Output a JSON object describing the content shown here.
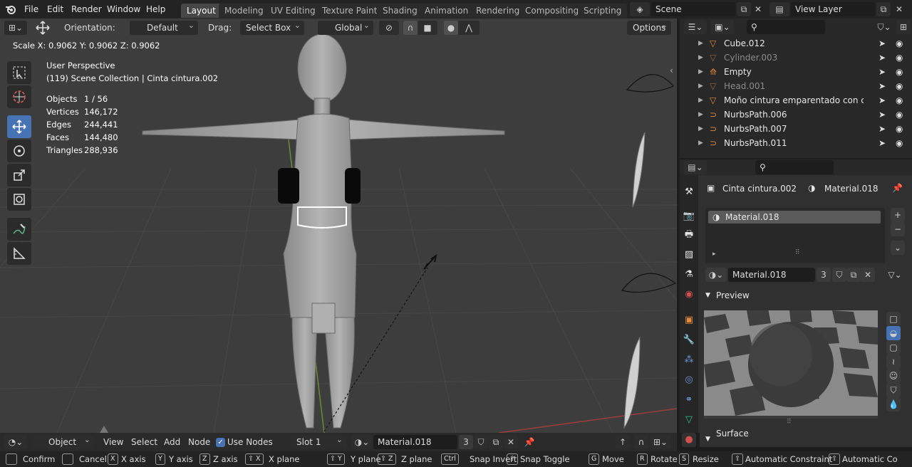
{
  "menus": [
    "File",
    "Edit",
    "Render",
    "Window",
    "Help"
  ],
  "workspaces": [
    "Layout",
    "Modeling",
    "UV Editing",
    "Texture Paint",
    "Shading",
    "Animation",
    "Rendering",
    "Compositing",
    "Scripting"
  ],
  "scene": {
    "name": "Scene",
    "view_layer": "View Layer"
  },
  "viewport_header": {
    "orientation_label": "Orientation:",
    "orientation_value": "Default",
    "drag_label": "Drag:",
    "drag_value": "Select Box",
    "transform_space": "Global",
    "options": "Options"
  },
  "operator_info": "Scale X: 0.9062   Y: 0.9062   Z: 0.9062",
  "viewport_info": {
    "perspective": "User Perspective",
    "collection": "(119) Scene Collection | Cinta cintura.002",
    "stats": [
      {
        "label": "Objects",
        "value": "1 / 56"
      },
      {
        "label": "Vertices",
        "value": "146,172"
      },
      {
        "label": "Edges",
        "value": "244,441"
      },
      {
        "label": "Faces",
        "value": "144,480"
      },
      {
        "label": "Triangles",
        "value": "288,936"
      }
    ]
  },
  "outliner": {
    "items": [
      {
        "name": "Cube.012",
        "icon": "mesh-icon",
        "dim": false
      },
      {
        "name": "Cylinder.003",
        "icon": "mesh-icon",
        "dim": true
      },
      {
        "name": "Empty",
        "icon": "empty-icon",
        "dim": false
      },
      {
        "name": "Head.001",
        "icon": "mesh-icon",
        "dim": true
      },
      {
        "name": "Moño cintura emparentado con cinta c",
        "icon": "mesh-icon",
        "dim": false
      },
      {
        "name": "NurbsPath.006",
        "icon": "curve-icon",
        "dim": false
      },
      {
        "name": "NurbsPath.007",
        "icon": "curve-icon",
        "dim": false
      },
      {
        "name": "NurbsPath.011",
        "icon": "curve-icon",
        "dim": false
      }
    ]
  },
  "properties": {
    "object_name": "Cinta cintura.002",
    "material_name": "Material.018",
    "slot_item": "Material.018",
    "material_field": "Material.018",
    "user_count": "3",
    "preview_label": "Preview",
    "surface_label": "Surface"
  },
  "node_bar": {
    "mode": "Object",
    "view": "View",
    "select": "Select",
    "add": "Add",
    "node": "Node",
    "use_nodes": "Use Nodes",
    "slot": "Slot 1",
    "material": "Material.018",
    "user_count": "3"
  },
  "status_bar": [
    {
      "key": "",
      "label": "Confirm"
    },
    {
      "key": "",
      "label": "Cancel"
    },
    {
      "key": "X",
      "label": "X axis"
    },
    {
      "key": "Y",
      "label": "Y axis"
    },
    {
      "key": "Z",
      "label": "Z axis"
    },
    {
      "key": "⇧ X",
      "label": "X plane"
    },
    {
      "key": "⇧ Y",
      "label": "Y plane"
    },
    {
      "key": "⇧ Z",
      "label": "Z plane"
    },
    {
      "key": "Ctrl",
      "label": "Snap Invert"
    },
    {
      "key": "⇧",
      "label": "Snap Toggle"
    },
    {
      "key": "G",
      "label": "Move"
    },
    {
      "key": "R",
      "label": "Rotate"
    },
    {
      "key": "S",
      "label": "Resize"
    },
    {
      "key": "⇧",
      "label": "Automatic Constraint"
    },
    {
      "key": "⇧",
      "label": "Automatic Co"
    }
  ],
  "colors": {
    "accent": "#4772b3",
    "mesh": "#e38a3d",
    "modifier": "#6f97d6",
    "data": "#27c38f"
  }
}
